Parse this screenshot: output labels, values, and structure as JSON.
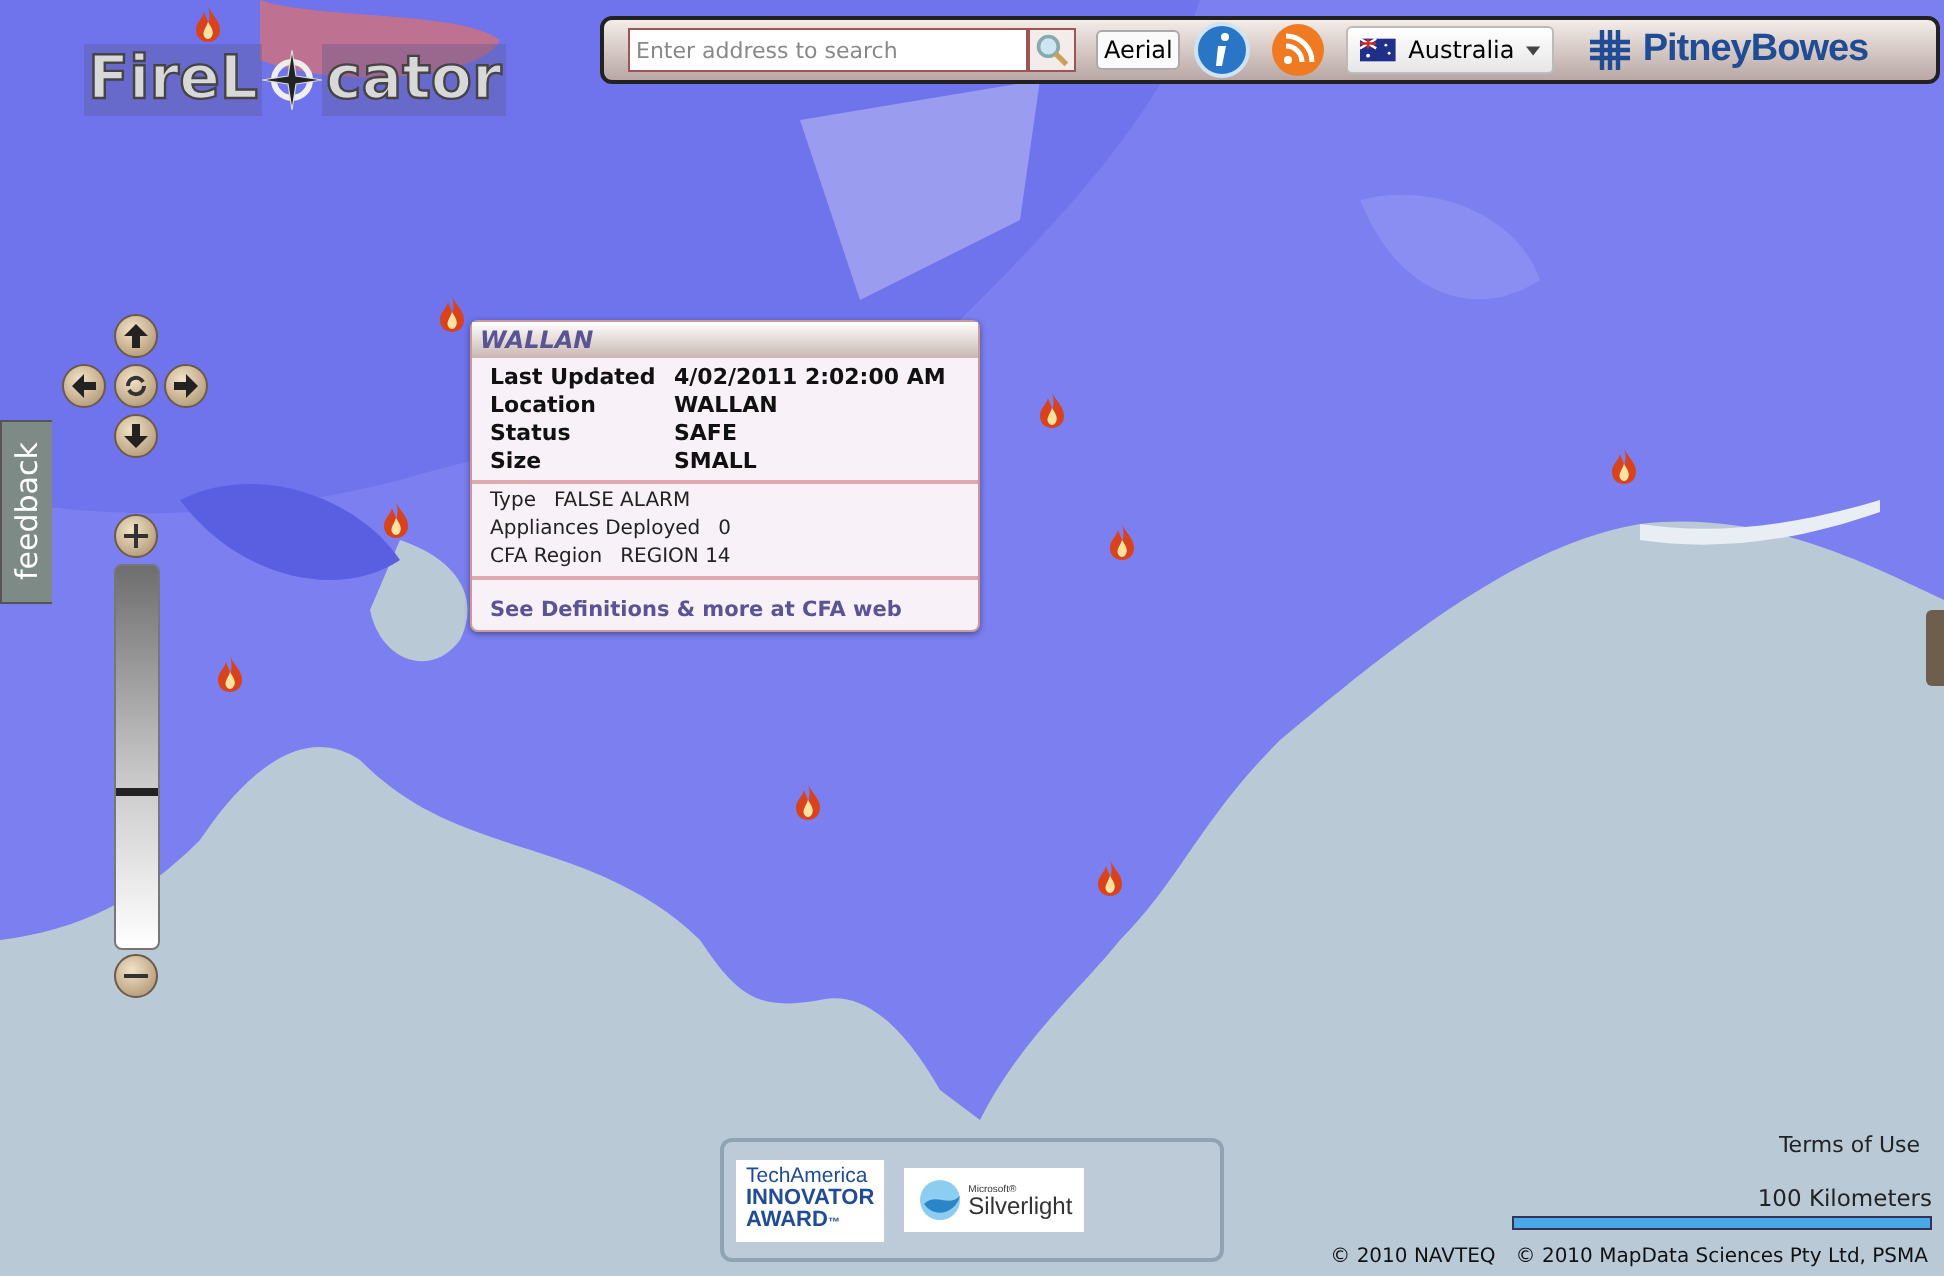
{
  "logo": {
    "before": "FireL",
    "after": "cator"
  },
  "toolbar": {
    "search": {
      "placeholder": "Enter address to search"
    },
    "map_style_button": "Aerial",
    "country": "Australia",
    "brand": "PitneyBowes"
  },
  "popup": {
    "title": "WALLAN",
    "main_rows": [
      {
        "label": "Last Updated",
        "value": "4/02/2011 2:02:00 AM"
      },
      {
        "label": "Location",
        "value": "WALLAN"
      },
      {
        "label": "Status",
        "value": "SAFE"
      },
      {
        "label": "Size",
        "value": "SMALL"
      }
    ],
    "detail_rows": [
      {
        "label": "Type",
        "value": "FALSE ALARM"
      },
      {
        "label": "Appliances Deployed",
        "value": "0"
      },
      {
        "label": "CFA Region",
        "value": "REGION 14"
      }
    ],
    "link": "See Definitions & more at CFA web"
  },
  "feedback_tab": "feedback",
  "zoom": {
    "level": 0.4
  },
  "awards": {
    "tech_lines": [
      "TechAmerica",
      "INNOVATOR",
      "AWARD"
    ],
    "tm": "™",
    "silverlight_small": "Microsoft®",
    "silverlight": "Silverlight"
  },
  "terms": "Terms of Use",
  "scale": "100 Kilometers",
  "copyright": [
    "© 2010 NAVTEQ",
    "© 2010 MapData Sciences Pty Ltd, PSMA"
  ]
}
